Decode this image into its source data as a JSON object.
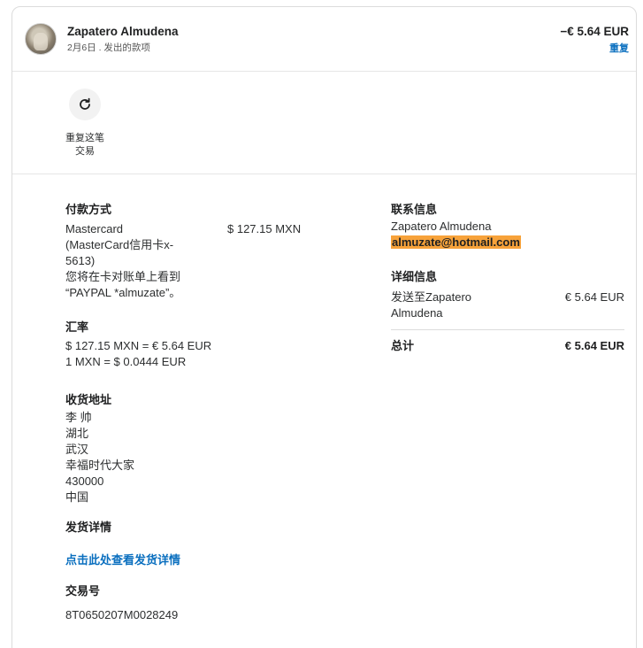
{
  "header": {
    "name": "Zapatero Almudena",
    "subtitle": "2月6日 . 发出的款项",
    "amount": "−€ 5.64 EUR",
    "repeat_link": "重复"
  },
  "action": {
    "icon": "refresh-icon",
    "label_line1": "重复这笔",
    "label_line2": "交易"
  },
  "payment": {
    "heading": "付款方式",
    "lines": [
      "Mastercard",
      "(MasterCard信用卡x-",
      "5613)",
      "您将在卡对账单上看到",
      "“PAYPAL *almuzate”。"
    ],
    "amount": "$ 127.15 MXN"
  },
  "exchange": {
    "heading": "汇率",
    "line1": "$ 127.15 MXN = € 5.64 EUR",
    "line2": "1 MXN = $ 0.0444 EUR"
  },
  "shipping": {
    "heading": "收货地址",
    "lines": [
      "李 帅",
      "湖北",
      "武汉",
      "幸福时代大家",
      "430000",
      "中国"
    ]
  },
  "delivery": {
    "heading": "发货详情",
    "link": "点击此处查看发货详情"
  },
  "transaction": {
    "heading": "交易号",
    "id": "8T0650207M0028249"
  },
  "contact": {
    "heading": "联系信息",
    "name": "Zapatero Almudena",
    "email": "almuzate@hotmail.com"
  },
  "details": {
    "heading": "详细信息",
    "sent_to_line1": "发送至Zapatero",
    "sent_to_line2": "Almudena",
    "sent_amount": "€ 5.64 EUR",
    "total_label": "总计",
    "total_amount": "€ 5.64 EUR"
  },
  "colors": {
    "accent": "#0a6fbf",
    "highlight": "#f7a23a"
  }
}
